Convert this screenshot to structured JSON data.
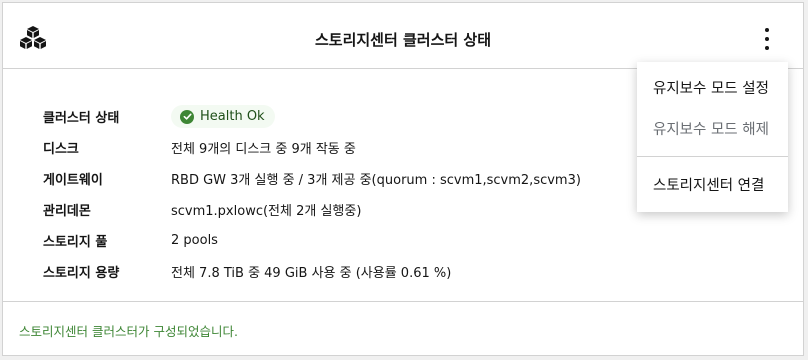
{
  "header": {
    "title": "스토리지센터 클러스터 상태",
    "logo_icon": "stacked-cubes-icon",
    "menu_icon": "kebab-icon"
  },
  "details": {
    "cluster_status": {
      "label": "클러스터 상태",
      "value": "Health Ok",
      "status_color": "#3e8635"
    },
    "disk": {
      "label": "디스크",
      "value": "전체 9개의 디스크 중 9개 작동 중"
    },
    "gateway": {
      "label": "게이트웨이",
      "value": "RBD GW 3개 실행 중 / 3개 제공 중(quorum : scvm1,scvm2,scvm3)"
    },
    "manager": {
      "label": "관리데몬",
      "value": "scvm1.pxlowc(전체 2개 실행중)"
    },
    "pool": {
      "label": "스토리지 풀",
      "value": "2 pools"
    },
    "capacity": {
      "label": "스토리지 용량",
      "value": "전체 7.8 TiB 중 49 GiB 사용 중 (사용률 0.61 %)"
    }
  },
  "footer": {
    "status_text": "스토리지센터 클러스터가 구성되었습니다.",
    "status_color": "#3e8635"
  },
  "dropdown": {
    "items": [
      {
        "label": "유지보수 모드 설정",
        "disabled": false
      },
      {
        "label": "유지보수 모드 해제",
        "disabled": true
      },
      {
        "label": "스토리지센터 연결",
        "disabled": false
      }
    ]
  }
}
